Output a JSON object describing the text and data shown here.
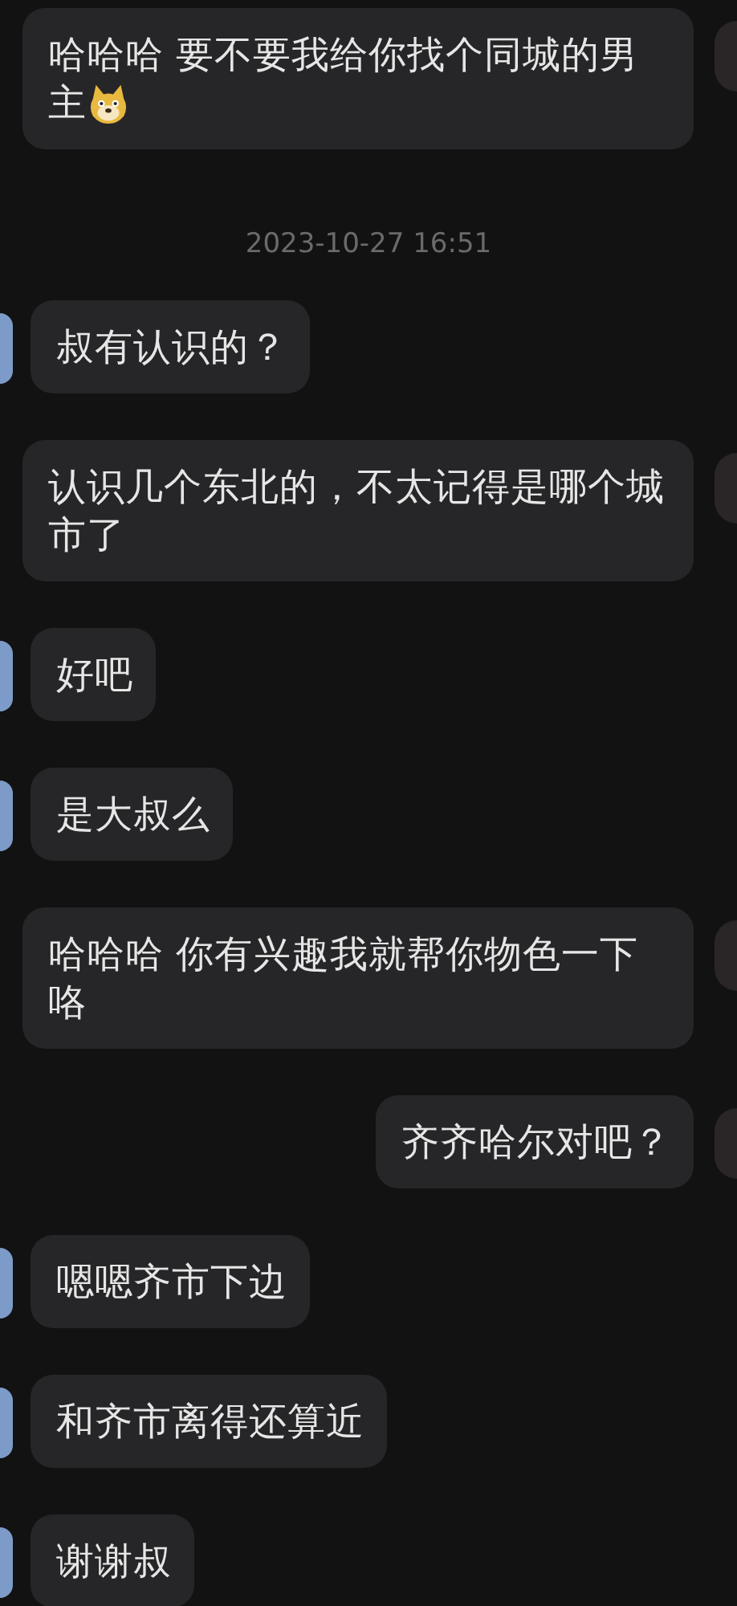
{
  "messages": [
    {
      "kind": "message",
      "outgoing": true,
      "text": "哈哈哈 要不要我给你找个同城的男主",
      "has_emoji": true
    },
    {
      "kind": "time",
      "text": "2023-10-27 16:51"
    },
    {
      "kind": "message",
      "outgoing": false,
      "text": "叔有认识的？",
      "has_emoji": false
    },
    {
      "kind": "message",
      "outgoing": true,
      "text": "认识几个东北的，不太记得是哪个城市了",
      "has_emoji": false
    },
    {
      "kind": "message",
      "outgoing": false,
      "text": "好吧",
      "has_emoji": false
    },
    {
      "kind": "message",
      "outgoing": false,
      "text": "是大叔么",
      "has_emoji": false
    },
    {
      "kind": "message",
      "outgoing": true,
      "text": "哈哈哈 你有兴趣我就帮你物色一下咯",
      "has_emoji": false
    },
    {
      "kind": "message",
      "outgoing": true,
      "text": "齐齐哈尔对吧？",
      "has_emoji": false
    },
    {
      "kind": "message",
      "outgoing": false,
      "text": "嗯嗯齐市下边",
      "has_emoji": false
    },
    {
      "kind": "message",
      "outgoing": false,
      "text": "和齐市离得还算近",
      "has_emoji": false
    },
    {
      "kind": "message",
      "outgoing": false,
      "text": "谢谢叔",
      "has_emoji": false
    }
  ]
}
